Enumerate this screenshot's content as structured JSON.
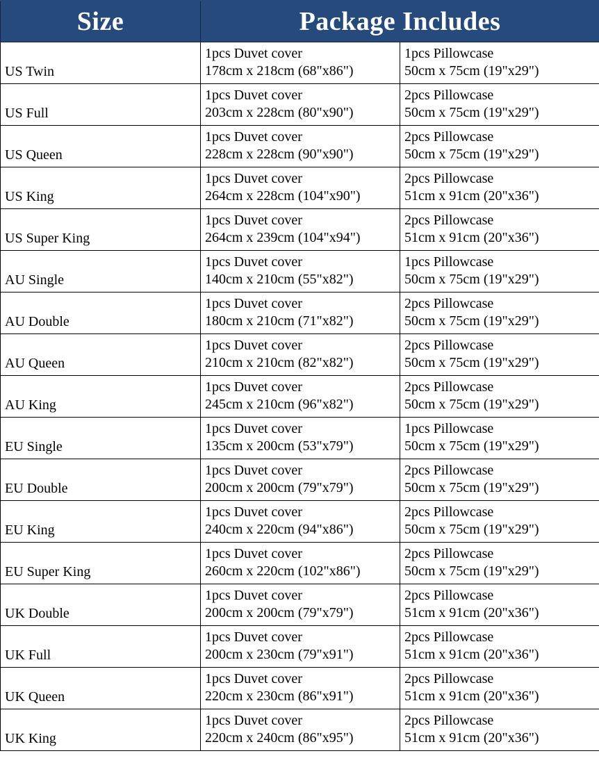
{
  "table": {
    "headers": {
      "size": "Size",
      "package": "Package Includes"
    },
    "header_bg": "#254a7b",
    "header_text_color": "#ffffff",
    "border_color": "#000000",
    "rows": [
      {
        "size": "US Twin",
        "duvet_label": "1pcs Duvet cover",
        "duvet_dims": "178cm x 218cm (68\"x86\")",
        "pillow_label": "1pcs Pillowcase",
        "pillow_dims": "50cm x 75cm (19\"x29\")"
      },
      {
        "size": "US Full",
        "duvet_label": "1pcs Duvet cover",
        "duvet_dims": "203cm x 228cm (80\"x90\")",
        "pillow_label": "2pcs Pillowcase",
        "pillow_dims": "50cm x 75cm (19\"x29\")"
      },
      {
        "size": "US Queen",
        "duvet_label": "1pcs Duvet cover",
        "duvet_dims": "228cm x 228cm (90\"x90\")",
        "pillow_label": "2pcs Pillowcase",
        "pillow_dims": "50cm x 75cm (19\"x29\")"
      },
      {
        "size": "US King",
        "duvet_label": "1pcs Duvet cover",
        "duvet_dims": "264cm x 228cm (104\"x90\")",
        "pillow_label": "2pcs Pillowcase",
        "pillow_dims": "51cm x 91cm (20\"x36\")"
      },
      {
        "size": "US Super King",
        "duvet_label": "1pcs Duvet cover",
        "duvet_dims": "264cm x 239cm (104\"x94\")",
        "pillow_label": "2pcs Pillowcase",
        "pillow_dims": "51cm x 91cm (20\"x36\")"
      },
      {
        "size": "AU Single",
        "duvet_label": "1pcs Duvet cover",
        "duvet_dims": "140cm x 210cm (55\"x82\")",
        "pillow_label": "1pcs Pillowcase",
        "pillow_dims": "50cm x 75cm (19\"x29\")"
      },
      {
        "size": "AU Double",
        "duvet_label": "1pcs Duvet cover",
        "duvet_dims": "180cm x 210cm (71\"x82\")",
        "pillow_label": "2pcs Pillowcase",
        "pillow_dims": "50cm x 75cm (19\"x29\")"
      },
      {
        "size": "AU Queen",
        "duvet_label": "1pcs Duvet cover",
        "duvet_dims": "210cm x 210cm (82\"x82\")",
        "pillow_label": "2pcs Pillowcase",
        "pillow_dims": "50cm x 75cm (19\"x29\")"
      },
      {
        "size": "AU King",
        "duvet_label": "1pcs Duvet cover",
        "duvet_dims": "245cm x 210cm (96\"x82\")",
        "pillow_label": "2pcs Pillowcase",
        "pillow_dims": "50cm x 75cm (19\"x29\")"
      },
      {
        "size": "EU Single",
        "duvet_label": "1pcs Duvet cover",
        "duvet_dims": "135cm x 200cm (53\"x79\")",
        "pillow_label": "1pcs Pillowcase",
        "pillow_dims": "50cm x 75cm (19\"x29\")"
      },
      {
        "size": "EU Double",
        "duvet_label": "1pcs Duvet cover",
        "duvet_dims": "200cm x 200cm (79\"x79\")",
        "pillow_label": "2pcs Pillowcase",
        "pillow_dims": "50cm x 75cm (19\"x29\")"
      },
      {
        "size": "EU King",
        "duvet_label": "1pcs Duvet cover",
        "duvet_dims": "240cm x 220cm (94\"x86\")",
        "pillow_label": "2pcs Pillowcase",
        "pillow_dims": "50cm x 75cm (19\"x29\")"
      },
      {
        "size": "EU Super King",
        "duvet_label": "1pcs Duvet cover",
        "duvet_dims": "260cm x 220cm (102\"x86\")",
        "pillow_label": "2pcs Pillowcase",
        "pillow_dims": "50cm x 75cm (19\"x29\")"
      },
      {
        "size": "UK Double",
        "duvet_label": "1pcs Duvet cover",
        "duvet_dims": "200cm x 200cm (79\"x79\")",
        "pillow_label": "2pcs Pillowcase",
        "pillow_dims": "51cm x 91cm (20\"x36\")"
      },
      {
        "size": "UK Full",
        "duvet_label": "1pcs Duvet cover",
        "duvet_dims": "200cm x 230cm (79\"x91\")",
        "pillow_label": "2pcs Pillowcase",
        "pillow_dims": "51cm x 91cm (20\"x36\")"
      },
      {
        "size": "UK Queen",
        "duvet_label": "1pcs Duvet cover",
        "duvet_dims": "220cm x 230cm (86\"x91\")",
        "pillow_label": "2pcs Pillowcase",
        "pillow_dims": "51cm x 91cm (20\"x36\")"
      },
      {
        "size": "UK King",
        "duvet_label": "1pcs Duvet cover",
        "duvet_dims": "220cm x 240cm (86\"x95\")",
        "pillow_label": "2pcs Pillowcase",
        "pillow_dims": "51cm x 91cm (20\"x36\")"
      }
    ]
  }
}
